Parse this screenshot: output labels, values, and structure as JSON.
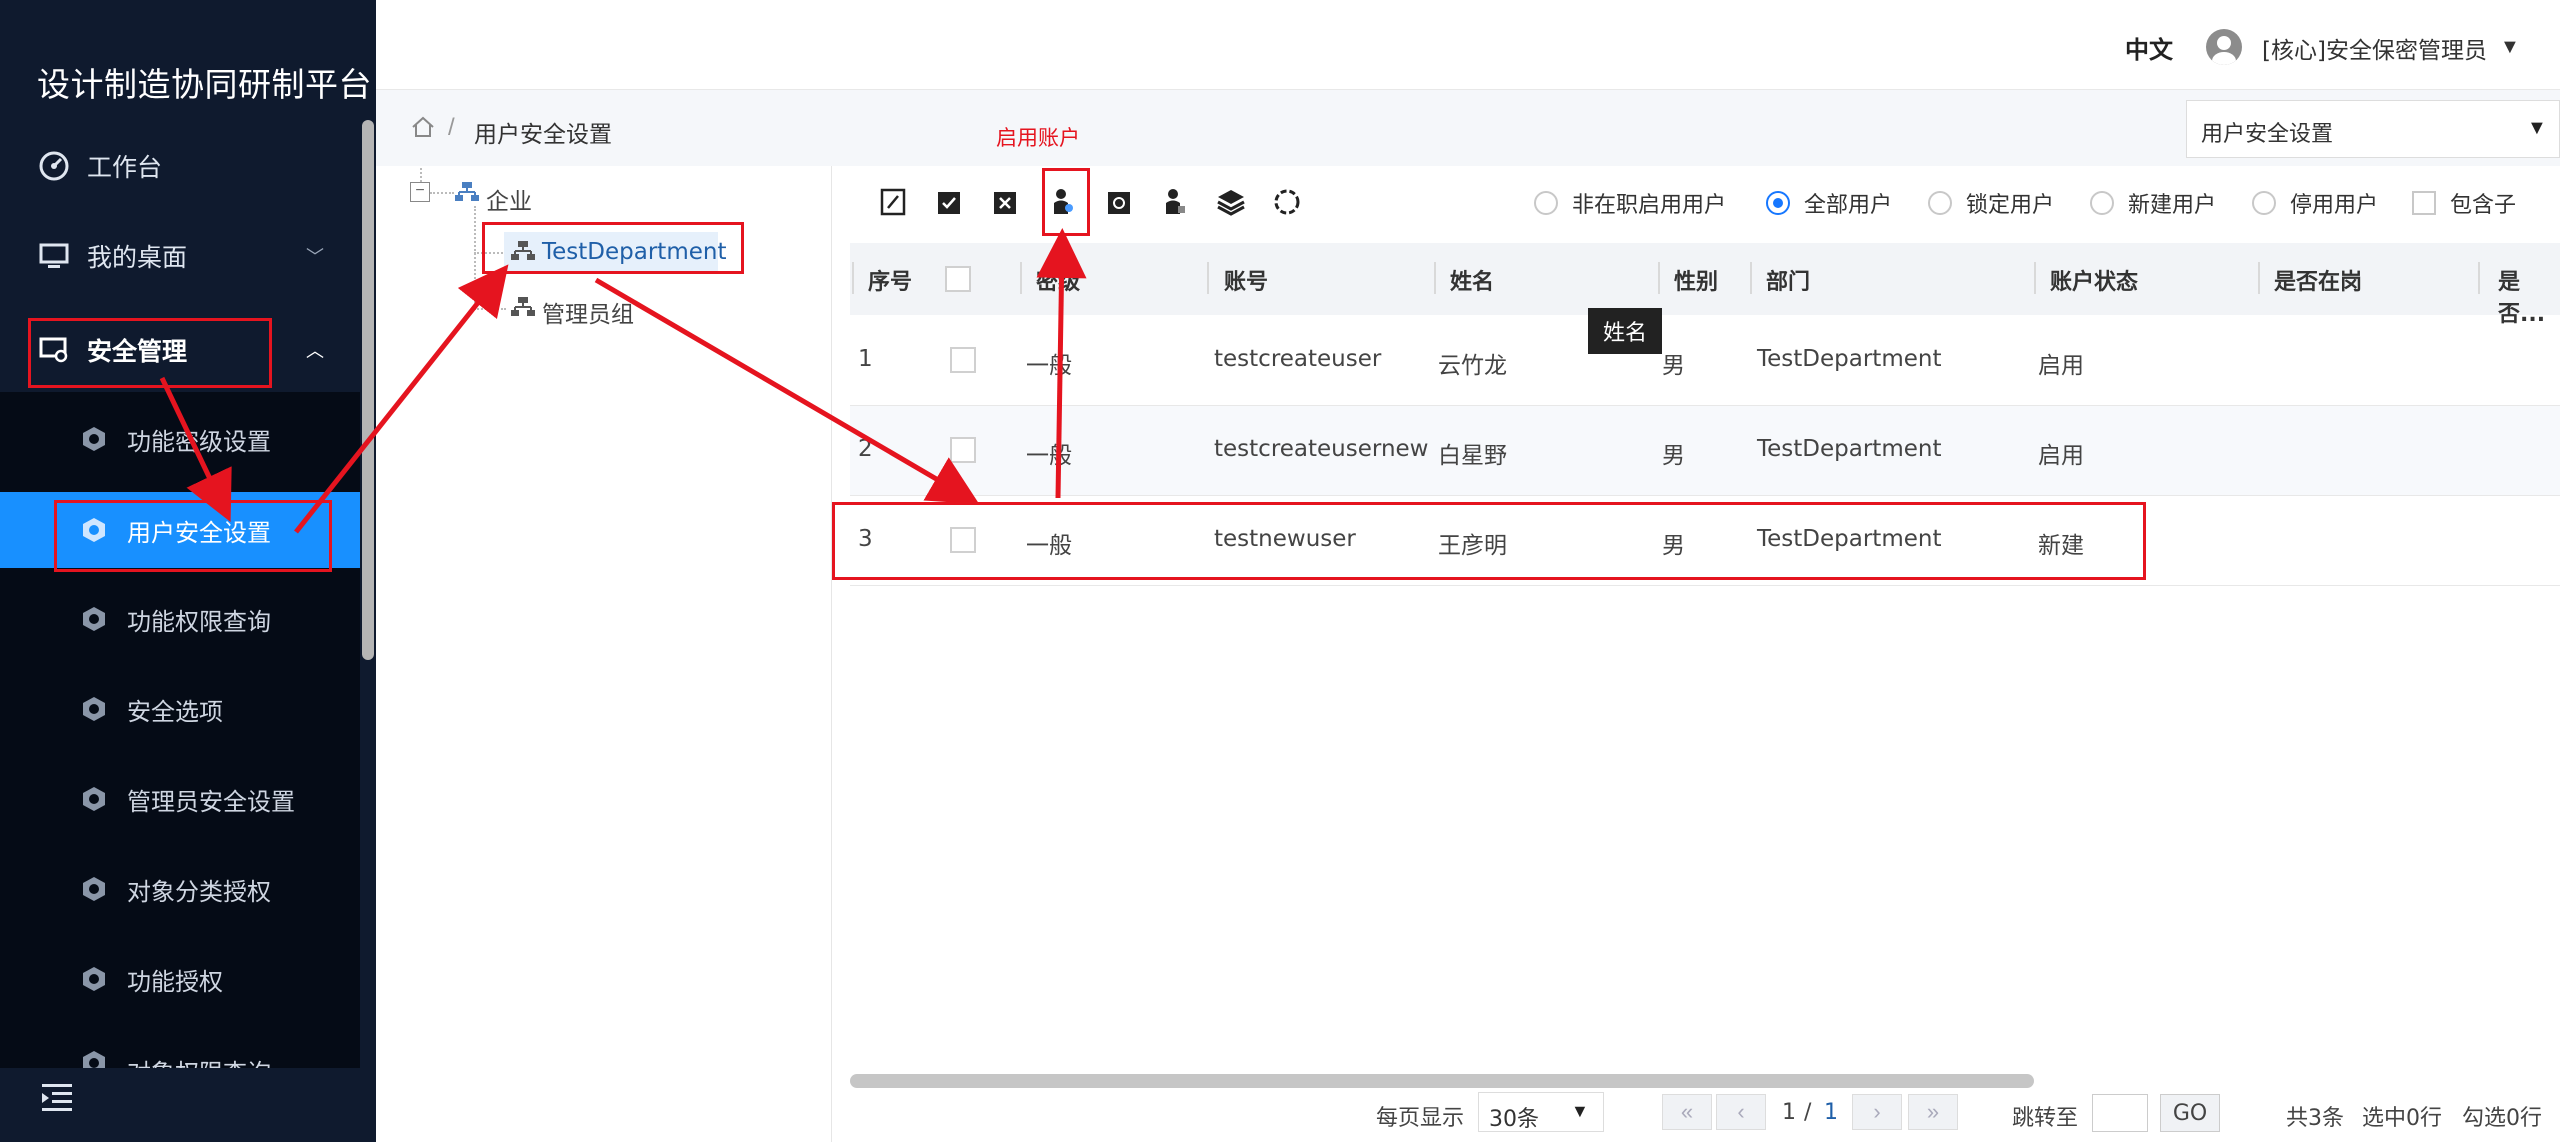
{
  "app": {
    "title": "设计制造协同研制平台"
  },
  "header": {
    "lang": "中文",
    "user": "[核心]安全保密管理员"
  },
  "sidebar": {
    "items": [
      {
        "label": "工作台",
        "icon": "dashboard-icon"
      },
      {
        "label": "我的桌面",
        "icon": "monitor-icon"
      },
      {
        "label": "安全管理",
        "icon": "security-monitor-icon"
      }
    ],
    "sub_items": [
      {
        "label": "功能密级设置"
      },
      {
        "label": "用户安全设置",
        "active": true
      },
      {
        "label": "功能权限查询"
      },
      {
        "label": "安全选项"
      },
      {
        "label": "管理员安全设置"
      },
      {
        "label": "对象分类授权"
      },
      {
        "label": "功能授权"
      },
      {
        "label": "对象权限查询"
      }
    ]
  },
  "breadcrumb": {
    "current": "用户安全设置",
    "select_value": "用户安全设置"
  },
  "tree": {
    "root": "企业",
    "children": [
      {
        "label": "TestDepartment",
        "selected": true
      },
      {
        "label": "管理员组"
      }
    ]
  },
  "annotation": {
    "label": "启用账户"
  },
  "filters": {
    "options": [
      {
        "label": "非在职启用用户",
        "checked": false
      },
      {
        "label": "全部用户",
        "checked": true
      },
      {
        "label": "锁定用户",
        "checked": false
      },
      {
        "label": "新建用户",
        "checked": false
      },
      {
        "label": "停用用户",
        "checked": false
      }
    ],
    "include_children": "包含子"
  },
  "table": {
    "columns": [
      "序号",
      "密级",
      "账号",
      "姓名",
      "性别",
      "部门",
      "账户状态",
      "是否在岗",
      "是否..."
    ],
    "rows": [
      {
        "no": "1",
        "level": "一般",
        "account": "testcreateuser",
        "name": "云竹龙",
        "gender": "男",
        "dept": "TestDepartment",
        "status": "启用"
      },
      {
        "no": "2",
        "level": "一般",
        "account": "testcreateusernew",
        "name": "白星野",
        "gender": "男",
        "dept": "TestDepartment",
        "status": "启用"
      },
      {
        "no": "3",
        "level": "一般",
        "account": "testnewuser",
        "name": "王彦明",
        "gender": "男",
        "dept": "TestDepartment",
        "status": "新建"
      }
    ],
    "tooltip": "姓名"
  },
  "pager": {
    "per_page_label": "每页显示",
    "per_page_value": "30条",
    "page_current": "1",
    "page_sep": "/",
    "page_total": "1",
    "jump_label": "跳转至",
    "go": "GO",
    "total": "共3条",
    "selected": "选中0行",
    "checked": "勾选0行"
  },
  "colors": {
    "accent": "#1890ff",
    "sidebar_bg": "#0f1a2e",
    "annotation": "#e5141f"
  }
}
